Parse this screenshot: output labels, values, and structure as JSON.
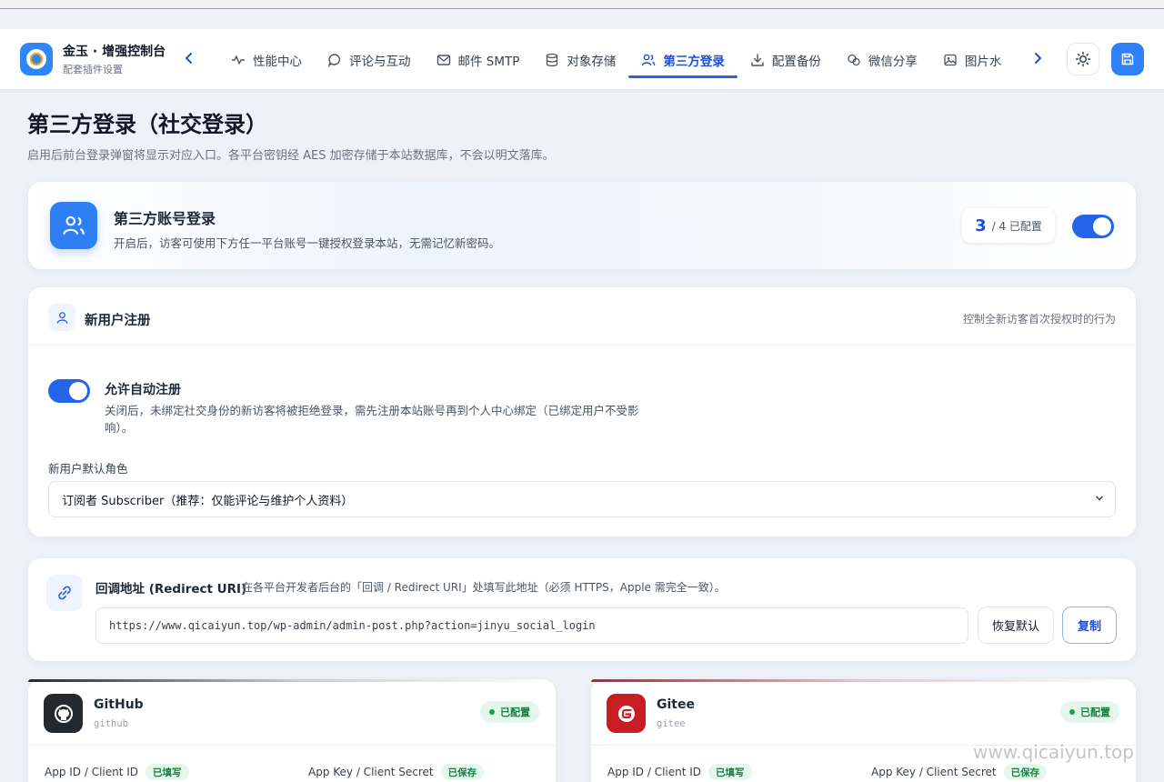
{
  "app": {
    "title": "金玉 · 增强控制台",
    "subtitle": "配套插件设置"
  },
  "nav": {
    "tabs": [
      {
        "label": "性能中心",
        "icon": "activity-icon"
      },
      {
        "label": "评论与互动",
        "icon": "message-icon"
      },
      {
        "label": "邮件 SMTP",
        "icon": "mail-icon"
      },
      {
        "label": "对象存储",
        "icon": "database-icon"
      },
      {
        "label": "第三方登录",
        "icon": "users-icon",
        "active": true
      },
      {
        "label": "配置备份",
        "icon": "download-icon"
      },
      {
        "label": "微信分享",
        "icon": "share-icon"
      },
      {
        "label": "图片水",
        "icon": "image-icon"
      }
    ]
  },
  "page": {
    "title": "第三方登录（社交登录）",
    "description": "启用后前台登录弹窗将显示对应入口。各平台密钥经 AES 加密存储于本站数据库，不会以明文落库。"
  },
  "hero": {
    "title": "第三方账号登录",
    "description": "开启后，访客可使用下方任一平台账号一键授权登录本站，无需记忆新密码。",
    "configured_count": "3",
    "configured_total": "/ 4 已配置",
    "enabled": true
  },
  "registration": {
    "title": "新用户注册",
    "hint": "控制全新访客首次授权时的行为",
    "auto_register_title": "允许自动注册",
    "auto_register_desc": "关闭后，未绑定社交身份的新访客将被拒绝登录，需先注册本站账号再到个人中心绑定（已绑定用户不受影响）。",
    "auto_register_enabled": true,
    "default_role_label": "新用户默认角色",
    "default_role_value": "订阅者 Subscriber（推荐：仅能评论与维护个人资料）"
  },
  "redirect": {
    "title": "回调地址 (Redirect URI)",
    "hint": "在各平台开发者后台的「回调 / Redirect URI」处填写此地址（必须 HTTPS，Apple 需完全一致）。",
    "url": "https://www.qicaiyun.top/wp-admin/admin-post.php?action=jinyu_social_login",
    "reset_label": "恢复默认",
    "copy_label": "复制"
  },
  "providers": [
    {
      "name": "GitHub",
      "slug": "github",
      "status": "已配置",
      "id_label": "App ID / Client ID",
      "id_status": "已填写",
      "secret_label": "App Key / Client Secret",
      "secret_status": "已保存",
      "color": "#24292f"
    },
    {
      "name": "Gitee",
      "slug": "gitee",
      "status": "已配置",
      "id_label": "App ID / Client ID",
      "id_status": "已填写",
      "secret_label": "App Key / Client Secret",
      "secret_status": "已保存",
      "color": "#c71d23"
    }
  ],
  "watermark": "www.qicaiyun.top",
  "colors": {
    "accent": "#2563eb",
    "success": "#16a34a",
    "background": "#eef2f8"
  }
}
